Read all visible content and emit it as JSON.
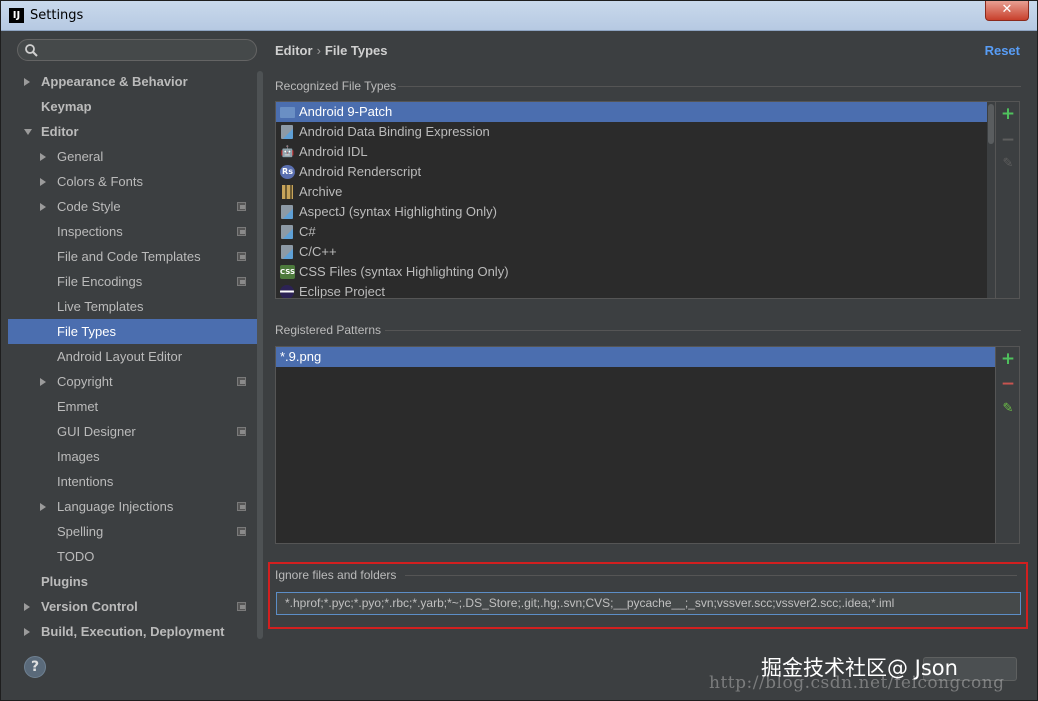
{
  "window": {
    "title": "Settings",
    "app_icon": "IJ",
    "close_label": "✕"
  },
  "search": {
    "placeholder": "",
    "value": ""
  },
  "sidebar": {
    "items": [
      {
        "label": "Appearance & Behavior",
        "bold": true,
        "indent": 0,
        "arrow": "right"
      },
      {
        "label": "Keymap",
        "bold": true,
        "indent": 0,
        "arrow": ""
      },
      {
        "label": "Editor",
        "bold": true,
        "indent": 0,
        "arrow": "down"
      },
      {
        "label": "General",
        "bold": false,
        "indent": 1,
        "arrow": "right"
      },
      {
        "label": "Colors & Fonts",
        "bold": false,
        "indent": 1,
        "arrow": "right"
      },
      {
        "label": "Code Style",
        "bold": false,
        "indent": 1,
        "arrow": "right",
        "project": true
      },
      {
        "label": "Inspections",
        "bold": false,
        "indent": 1,
        "arrow": "",
        "project": true
      },
      {
        "label": "File and Code Templates",
        "bold": false,
        "indent": 1,
        "arrow": "",
        "project": true
      },
      {
        "label": "File Encodings",
        "bold": false,
        "indent": 1,
        "arrow": "",
        "project": true
      },
      {
        "label": "Live Templates",
        "bold": false,
        "indent": 1,
        "arrow": ""
      },
      {
        "label": "File Types",
        "bold": false,
        "indent": 1,
        "arrow": "",
        "selected": true
      },
      {
        "label": "Android Layout Editor",
        "bold": false,
        "indent": 1,
        "arrow": ""
      },
      {
        "label": "Copyright",
        "bold": false,
        "indent": 1,
        "arrow": "right",
        "project": true
      },
      {
        "label": "Emmet",
        "bold": false,
        "indent": 1,
        "arrow": ""
      },
      {
        "label": "GUI Designer",
        "bold": false,
        "indent": 1,
        "arrow": "",
        "project": true
      },
      {
        "label": "Images",
        "bold": false,
        "indent": 1,
        "arrow": ""
      },
      {
        "label": "Intentions",
        "bold": false,
        "indent": 1,
        "arrow": ""
      },
      {
        "label": "Language Injections",
        "bold": false,
        "indent": 1,
        "arrow": "right",
        "project": true
      },
      {
        "label": "Spelling",
        "bold": false,
        "indent": 1,
        "arrow": "",
        "project": true
      },
      {
        "label": "TODO",
        "bold": false,
        "indent": 1,
        "arrow": ""
      },
      {
        "label": "Plugins",
        "bold": true,
        "indent": 0,
        "arrow": ""
      },
      {
        "label": "Version Control",
        "bold": true,
        "indent": 0,
        "arrow": "right",
        "project": true
      },
      {
        "label": "Build, Execution, Deployment",
        "bold": true,
        "indent": 0,
        "arrow": "right"
      }
    ]
  },
  "breadcrumb": {
    "parent": "Editor",
    "separator": "›",
    "current": "File Types"
  },
  "reset_label": "Reset",
  "recognized": {
    "label": "Recognized File Types",
    "items": [
      {
        "label": "Android 9-Patch",
        "icon": "folder-icon",
        "color": "#6a8fc4",
        "glyph": "",
        "selected": true
      },
      {
        "label": "Android Data Binding Expression",
        "icon": "file-person-icon",
        "color": "#8d9aa6",
        "glyph": ""
      },
      {
        "label": "Android IDL",
        "icon": "android-icon",
        "color": "#8bc34a",
        "glyph": "🤖"
      },
      {
        "label": "Android Renderscript",
        "icon": "renderscript-icon",
        "color": "#5a6fb0",
        "glyph": "Rs"
      },
      {
        "label": "Archive",
        "icon": "archive-icon",
        "color": "#c8a45a",
        "glyph": ""
      },
      {
        "label": "AspectJ (syntax Highlighting Only)",
        "icon": "file-person-icon",
        "color": "#8d9aa6",
        "glyph": ""
      },
      {
        "label": "C#",
        "icon": "file-person-icon",
        "color": "#8d9aa6",
        "glyph": ""
      },
      {
        "label": "C/C++",
        "icon": "file-person-icon",
        "color": "#8d9aa6",
        "glyph": ""
      },
      {
        "label": "CSS Files (syntax Highlighting Only)",
        "icon": "css-icon",
        "color": "#4d7a3c",
        "glyph": "CSS"
      },
      {
        "label": "Eclipse Project",
        "icon": "eclipse-icon",
        "color": "#4b3e8a",
        "glyph": ""
      }
    ]
  },
  "patterns": {
    "label": "Registered Patterns",
    "items": [
      {
        "label": "*.9.png",
        "selected": true
      }
    ]
  },
  "tools": {
    "add": "+",
    "remove": "−",
    "edit": "✎"
  },
  "colors": {
    "add": "#4fc15d",
    "remove": "#c75450",
    "edit_active": "#6cbf47",
    "disabled": "#5e5e5e",
    "accent": "#4b6eaf",
    "highlight": "#d21f1f"
  },
  "ignore": {
    "label": "Ignore files and folders",
    "value": "*.hprof;*.pyc;*.pyo;*.rbc;*.yarb;*~;.DS_Store;.git;.hg;.svn;CVS;__pycache__;_svn;vssver.scc;vssver2.scc;.idea;*.iml"
  },
  "footer": {
    "help": "?",
    "watermark_cn": "掘金技术社区@ Json",
    "watermark_url": "http://blog.csdn.net/feicongcong"
  }
}
